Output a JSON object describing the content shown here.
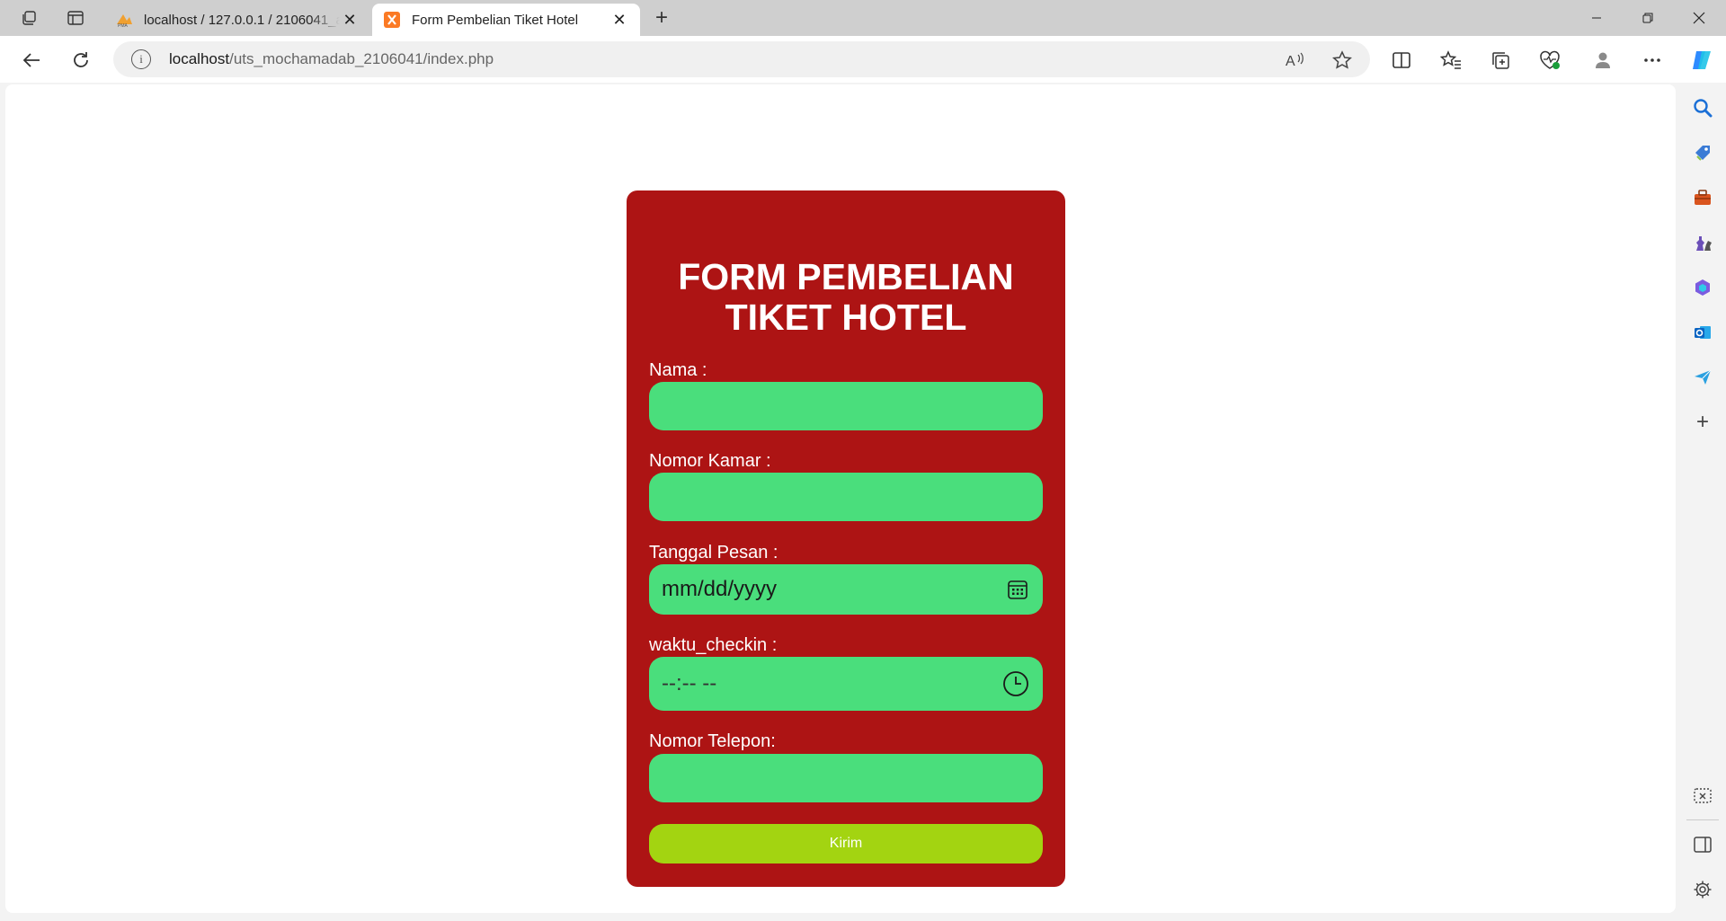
{
  "browser": {
    "tabs": [
      {
        "title": "localhost / 127.0.0.1 / 2106041_a",
        "active": false
      },
      {
        "title": "Form Pembelian Tiket Hotel",
        "active": true
      }
    ],
    "address": {
      "host": "localhost",
      "path": "/uts_mochamadab_2106041/index.php"
    },
    "icons": [
      "workspaces-icon",
      "vertical-tabs-icon",
      "back-icon",
      "refresh-icon",
      "read-aloud-icon",
      "favorite-star-icon",
      "split-screen-icon",
      "favorites-icon",
      "collections-icon",
      "health-icon",
      "profile-icon",
      "more-icon",
      "copilot-icon"
    ]
  },
  "sidebar": {
    "icons": [
      "search-icon",
      "shopping-tag-icon",
      "tools-icon",
      "games-icon",
      "microsoft365-icon",
      "outlook-icon",
      "send-icon",
      "add-icon",
      "screenshot-icon",
      "sidebar-toggle-icon",
      "settings-icon"
    ]
  },
  "form": {
    "title": "FORM PEMBELIAN TIKET HOTEL",
    "fields": [
      {
        "label": "Nama :",
        "placeholder": ""
      },
      {
        "label": "Nomor Kamar :",
        "placeholder": ""
      },
      {
        "label": "Tanggal Pesan :",
        "placeholder": "mm/dd/yyyy"
      },
      {
        "label": "waktu_checkin :",
        "placeholder": "--:-- --"
      },
      {
        "label": "Nomor Telepon:",
        "placeholder": ""
      }
    ],
    "submit_label": "Kirim"
  },
  "colors": {
    "card_bg": "#ad1414",
    "field_bg": "#4ade7c",
    "button_bg": "#a3d411"
  }
}
